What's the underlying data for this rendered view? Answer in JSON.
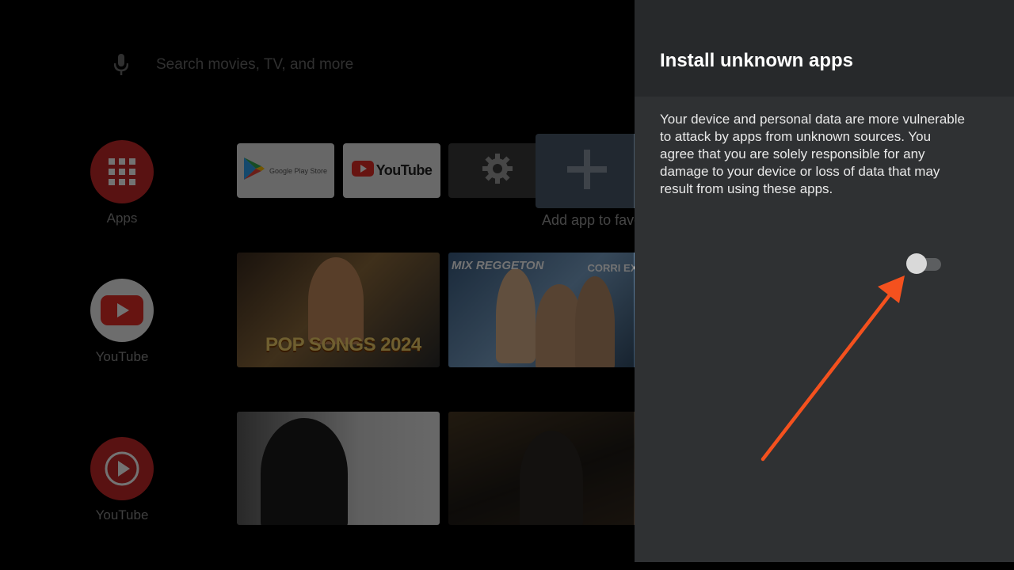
{
  "search": {
    "placeholder": "Search movies, TV, and more"
  },
  "rail": [
    {
      "label": "Apps",
      "color": "#c62828"
    },
    {
      "label": "YouTube",
      "color": "#f2f2f2"
    },
    {
      "label": "YouTube",
      "color": "#c62828"
    }
  ],
  "favorites": {
    "play_label": "Google Play Store",
    "youtube_label": "YouTube",
    "add_label": "Add app to favorites"
  },
  "thumbnails": [
    {
      "title": "POP SONGS 2024"
    },
    {
      "title_left": "MIX REGGETON",
      "title_right": "CORRI EXI"
    },
    {
      "title": ""
    },
    {
      "title": ""
    }
  ],
  "panel": {
    "title": "Install unknown apps",
    "description": "Your device and personal data are more vulnerable to attack by apps from unknown sources. You agree that you are solely responsible for any damage to your device or loss of data that may result from using these apps.",
    "toggle_on": false
  },
  "annotation": {
    "arrow_color": "#f4511e"
  }
}
